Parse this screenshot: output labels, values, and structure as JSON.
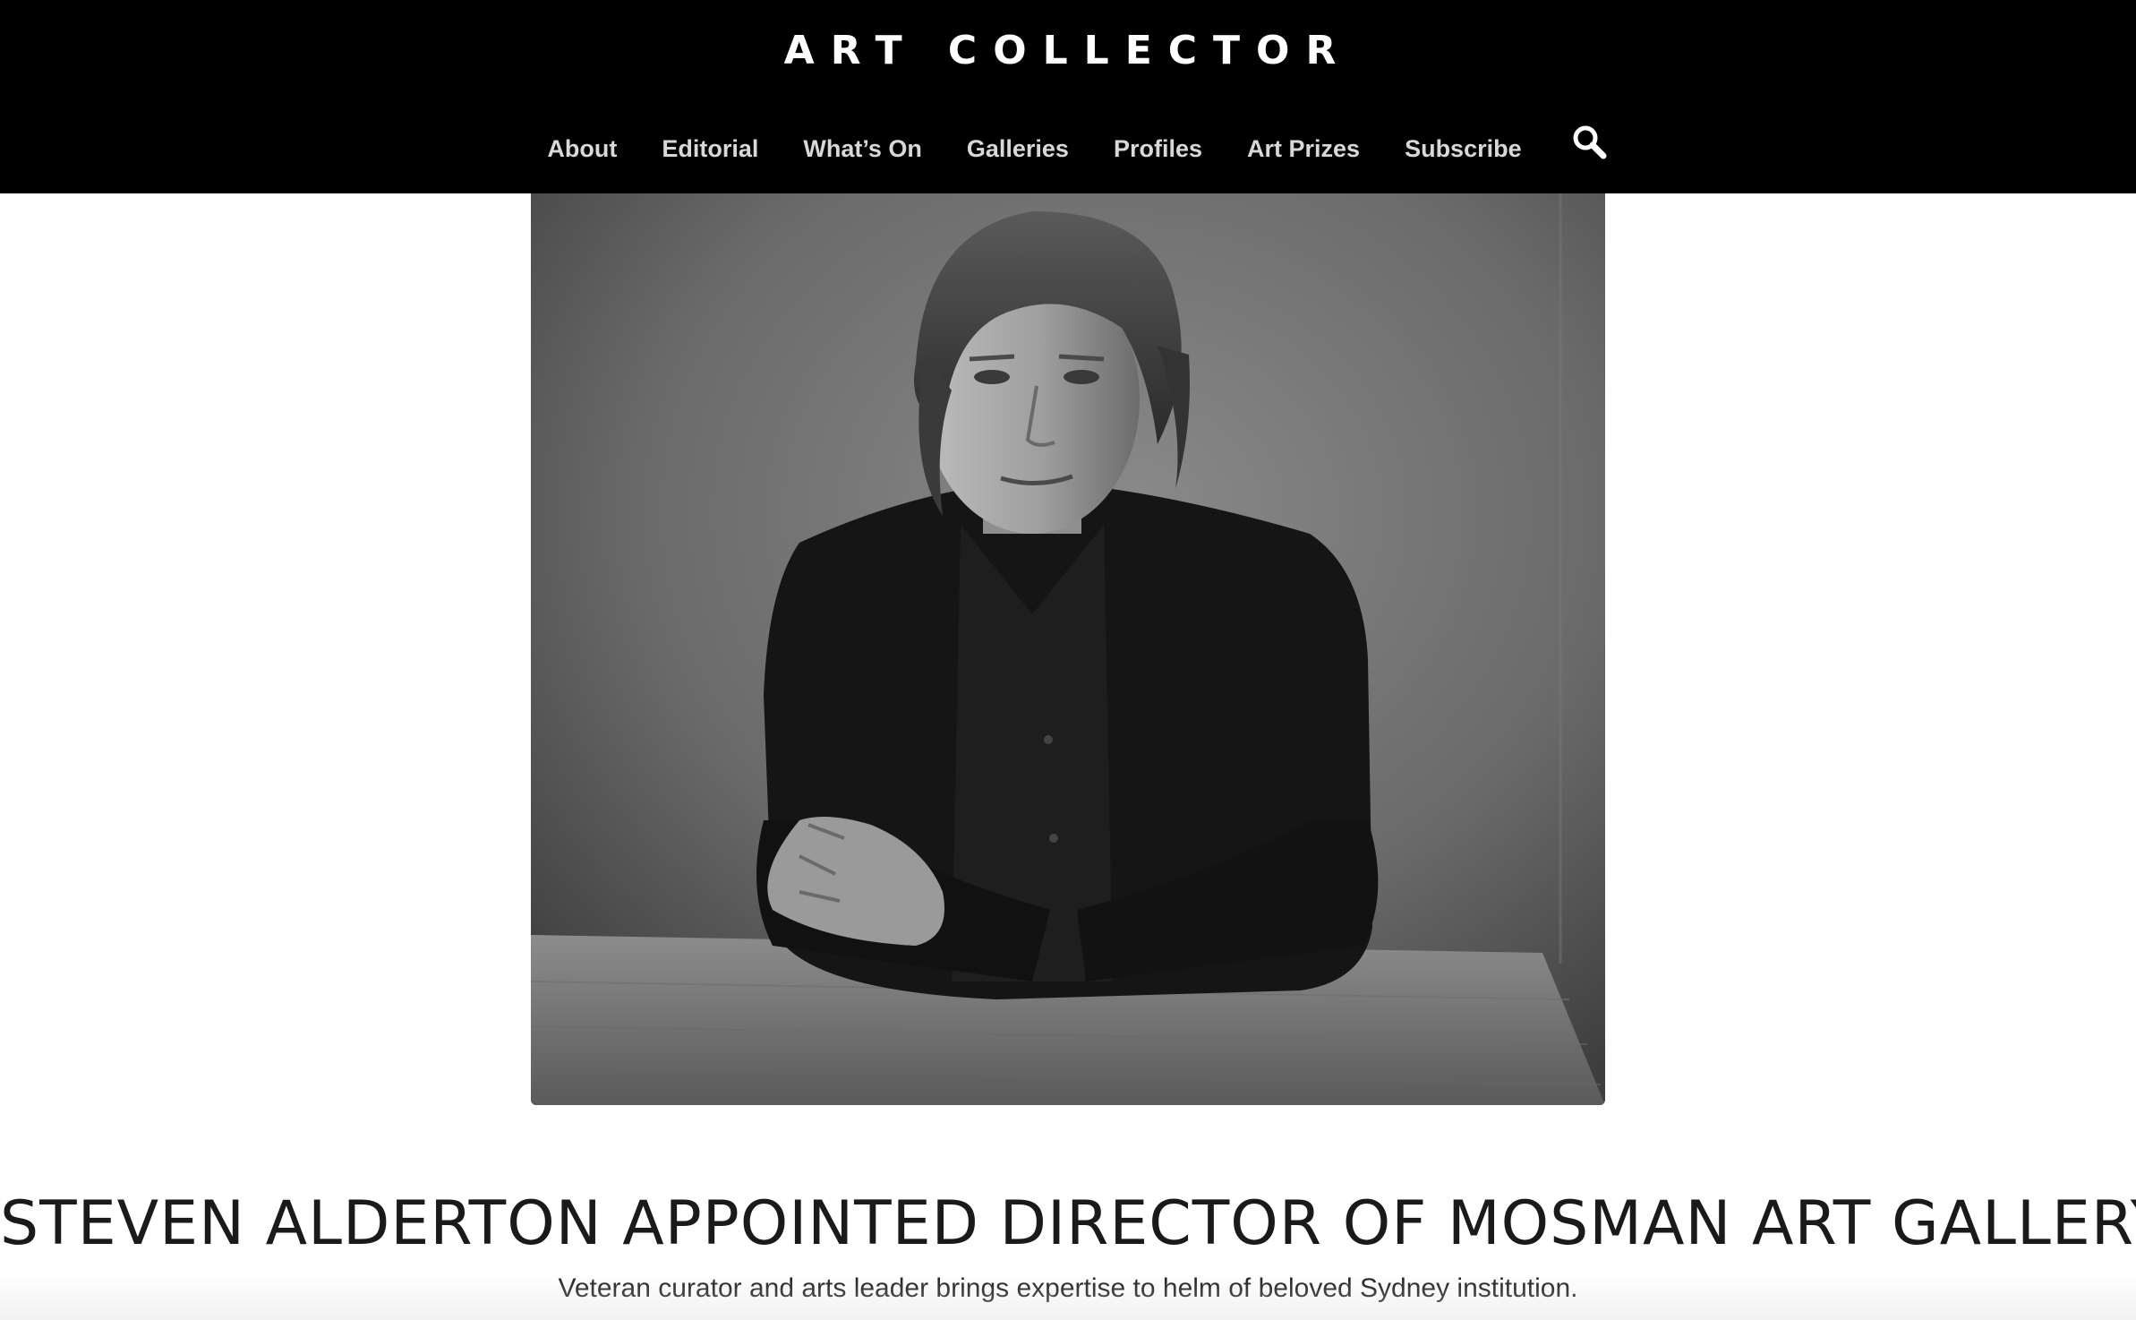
{
  "header": {
    "logo_text": "ART COLLECTOR",
    "background_color": "#000000",
    "text_color": "#ffffff"
  },
  "nav": {
    "items": [
      {
        "label": "About"
      },
      {
        "label": "Editorial"
      },
      {
        "label": "What’s On"
      },
      {
        "label": "Galleries"
      },
      {
        "label": "Profiles"
      },
      {
        "label": "Art Prizes"
      },
      {
        "label": "Subscribe"
      }
    ],
    "search_icon": "search-icon"
  },
  "article": {
    "hero_image": "black-and-white portrait photo",
    "title": "STEVEN ALDERTON APPOINTED DIRECTOR OF MOSMAN ART GALLERY",
    "subtitle": "Veteran curator and arts leader brings expertise to helm of beloved Sydney institution."
  }
}
